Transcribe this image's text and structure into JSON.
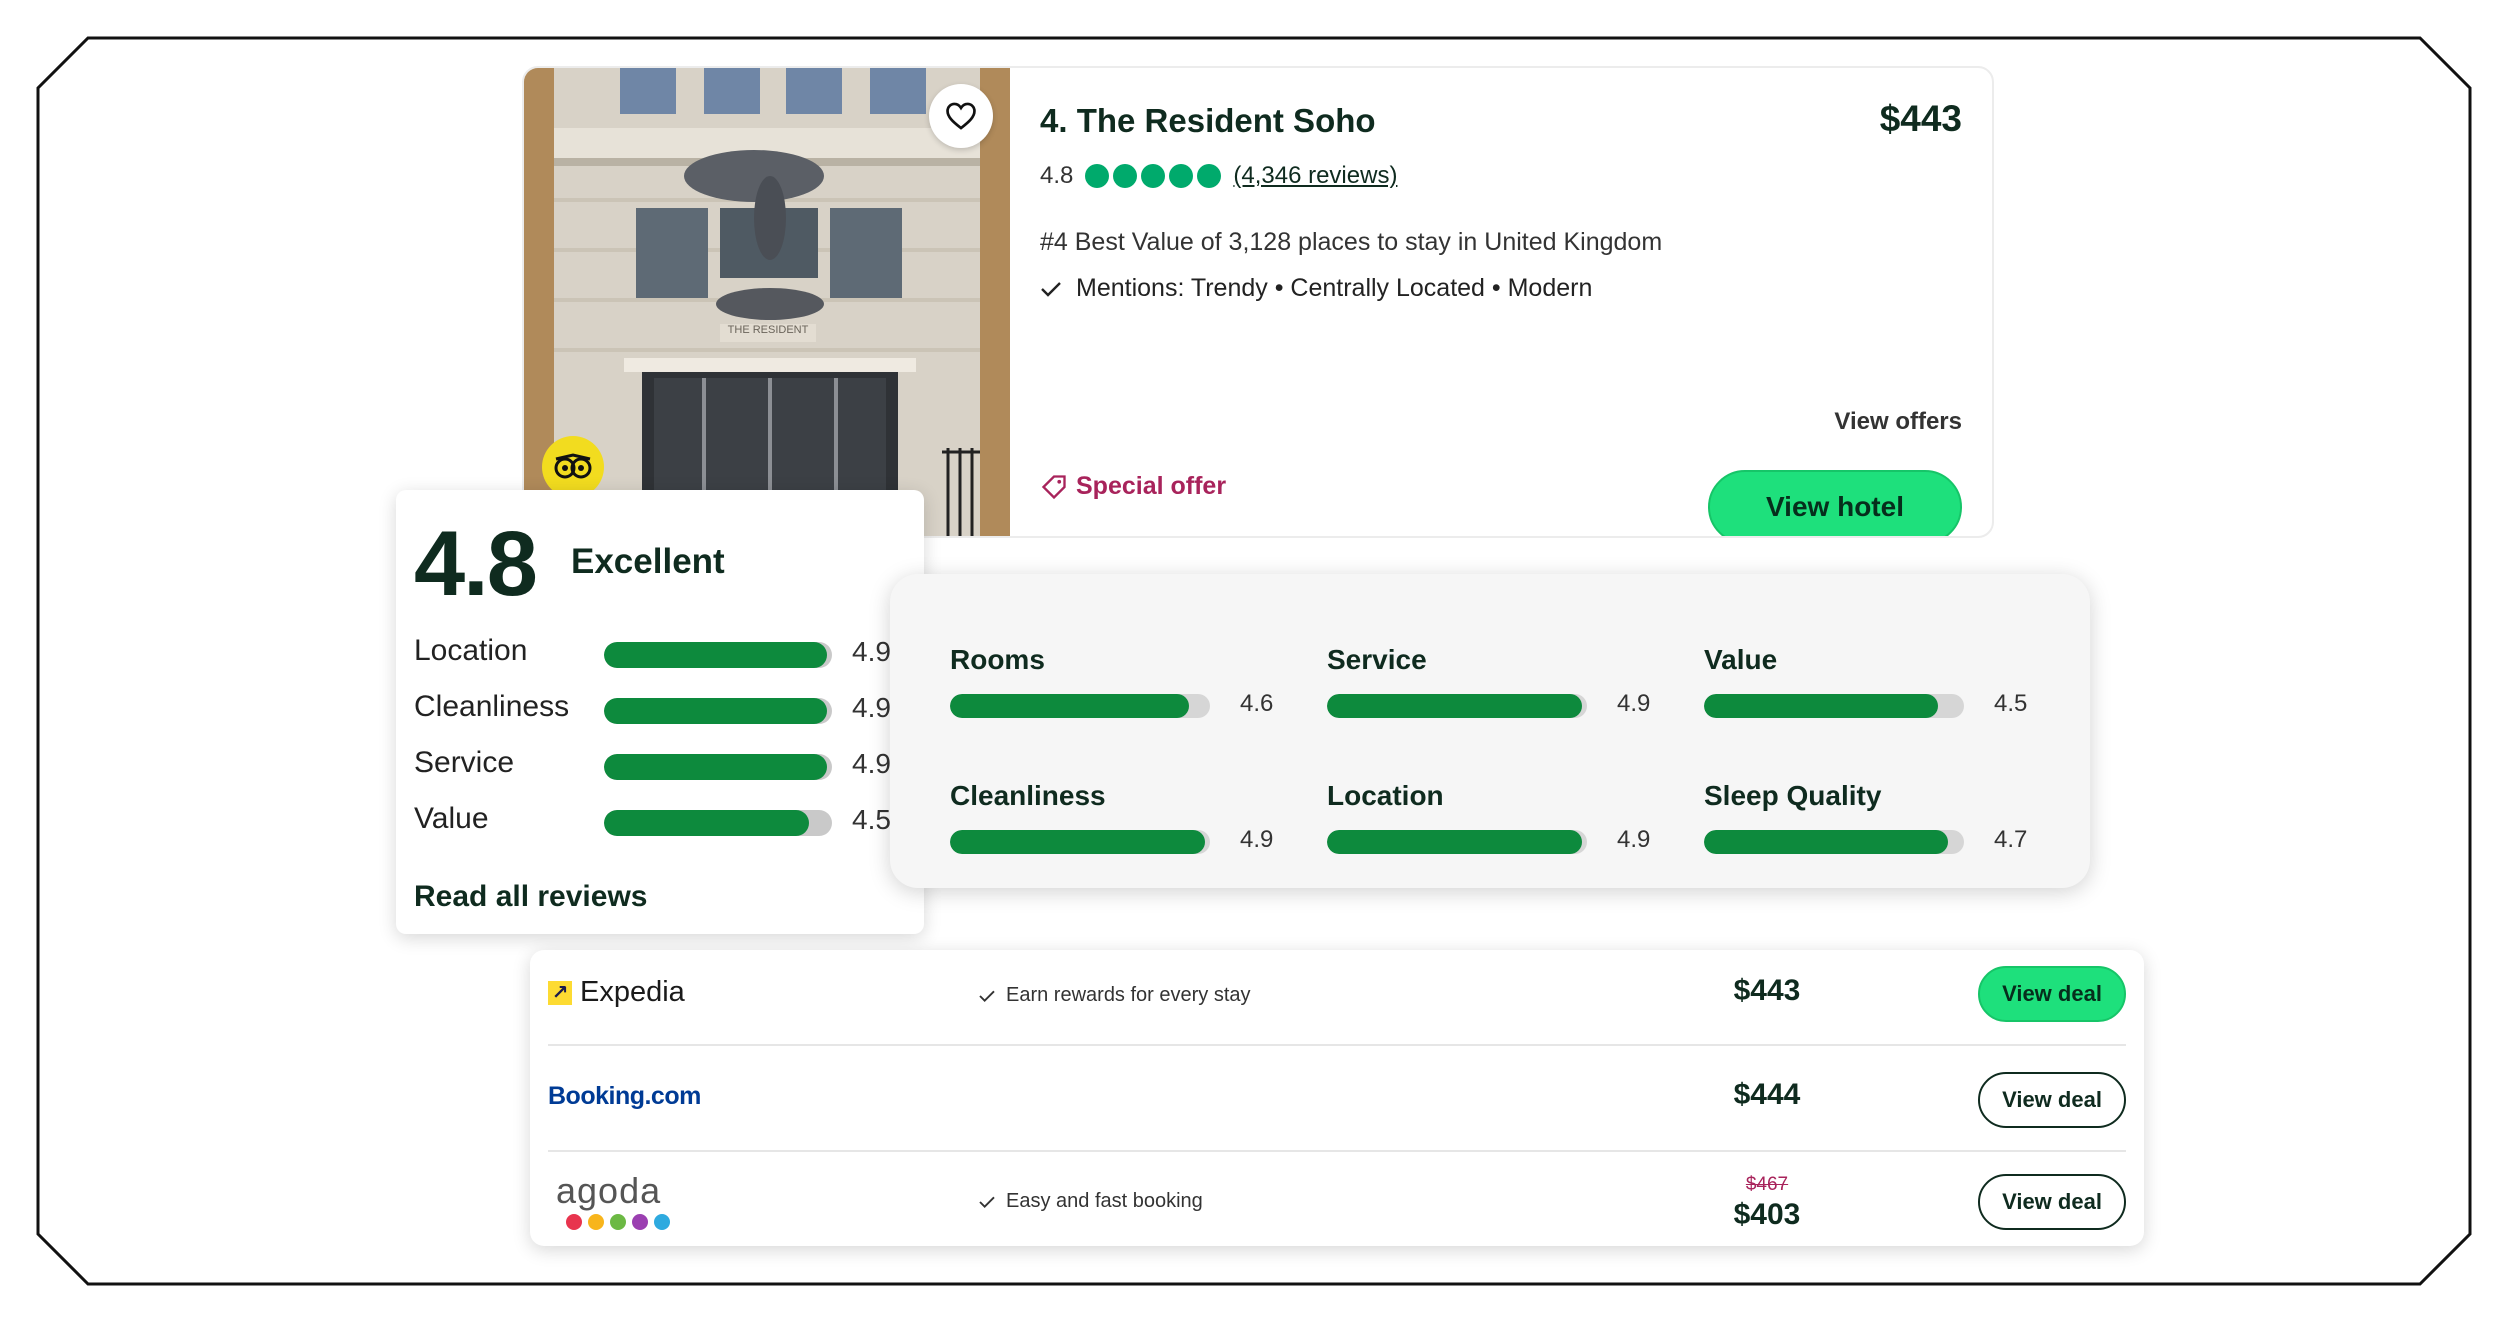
{
  "hotel": {
    "title": "4. The Resident Soho",
    "price": "$443",
    "rating": "4.8",
    "reviews_link": "(4,346 reviews)",
    "best_value": "#4 Best Value of 3,128 places to stay in United Kingdom",
    "mentions": "Mentions: Trendy • Centrally Located • Modern",
    "view_offers": "View offers",
    "special_offer": "Special offer",
    "view_hotel_label": "View hotel",
    "facade_sign": "THE RESIDENT"
  },
  "score_card": {
    "score": "4.8",
    "label": "Excellent",
    "rows": [
      {
        "label": "Location",
        "value": "4.9",
        "fraction": 0.98
      },
      {
        "label": "Cleanliness",
        "value": "4.9",
        "fraction": 0.98
      },
      {
        "label": "Service",
        "value": "4.9",
        "fraction": 0.98
      },
      {
        "label": "Value",
        "value": "4.5",
        "fraction": 0.9
      }
    ],
    "read_all": "Read all reviews"
  },
  "subratings": [
    {
      "label": "Rooms",
      "value": "4.6",
      "fraction": 0.92
    },
    {
      "label": "Service",
      "value": "4.9",
      "fraction": 0.98
    },
    {
      "label": "Value",
      "value": "4.5",
      "fraction": 0.9
    },
    {
      "label": "Cleanliness",
      "value": "4.9",
      "fraction": 0.98
    },
    {
      "label": "Location",
      "value": "4.9",
      "fraction": 0.98
    },
    {
      "label": "Sleep Quality",
      "value": "4.7",
      "fraction": 0.94
    }
  ],
  "deals": [
    {
      "provider": "Expedia",
      "perk": "Earn rewards for every stay",
      "price": "$443",
      "old_price": "",
      "button": "View deal"
    },
    {
      "provider": "Booking.com",
      "perk": "",
      "price": "$444",
      "old_price": "",
      "button": "View deal"
    },
    {
      "provider": "agoda",
      "perk": "Easy and fast booking",
      "price": "$403",
      "old_price": "$467",
      "button": "View deal"
    }
  ],
  "colors": {
    "accent_green": "#1ee07c",
    "bar_green": "#0d8a3d",
    "bubble_green": "#00aa6c",
    "special_offer": "#a8235b",
    "agoda_dots": [
      "#e8344e",
      "#f8b51c",
      "#6cb944",
      "#9b3fb1",
      "#2eaadf"
    ]
  },
  "icons": {
    "favorite": "heart-icon",
    "award": "tripadvisor-owl-icon",
    "check": "check-icon",
    "offer": "tag-icon"
  }
}
